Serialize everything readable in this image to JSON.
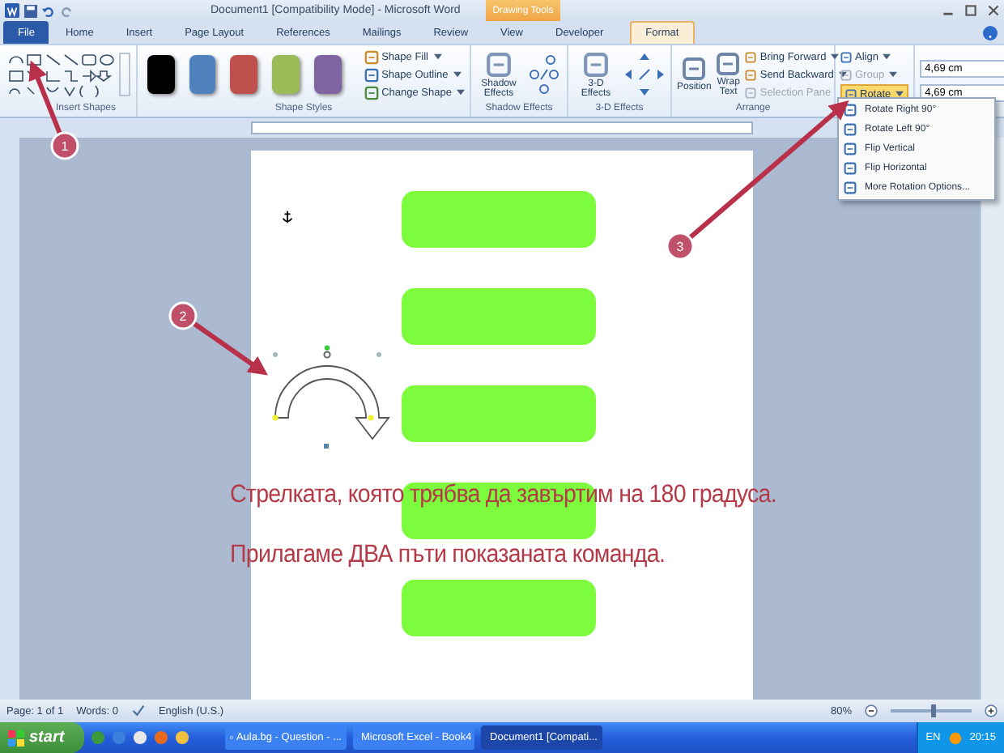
{
  "title_bar": {
    "title": "Document1 [Compatibility Mode] - Microsoft Word",
    "contextual": "Drawing Tools"
  },
  "tabs": [
    {
      "label": "File",
      "kind": "file",
      "selected": false
    },
    {
      "label": "Home",
      "kind": "tab",
      "selected": false
    },
    {
      "label": "Insert",
      "kind": "tab",
      "selected": false
    },
    {
      "label": "Page Layout",
      "kind": "tab",
      "selected": false
    },
    {
      "label": "References",
      "kind": "tab",
      "selected": false
    },
    {
      "label": "Mailings",
      "kind": "tab",
      "selected": false
    },
    {
      "label": "Review",
      "kind": "tab",
      "selected": false
    },
    {
      "label": "View",
      "kind": "tab",
      "selected": false
    },
    {
      "label": "Developer",
      "kind": "tab",
      "selected": false
    },
    {
      "label": "Format",
      "kind": "tab",
      "selected": true
    }
  ],
  "ribbon": {
    "insert_shapes": {
      "label": "Insert Shapes"
    },
    "shape_styles": {
      "label": "Shape Styles",
      "swatches": [
        {
          "color": "#000000"
        },
        {
          "color": "#4f81bd"
        },
        {
          "color": "#c0504d"
        },
        {
          "color": "#9bbb59"
        },
        {
          "color": "#8064a2"
        }
      ],
      "commands": [
        "Shape Fill",
        "Shape Outline",
        "Change Shape"
      ]
    },
    "shadow_effects": {
      "label": "Shadow Effects",
      "button": "Shadow Effects"
    },
    "three_d_effects": {
      "label": "3-D Effects",
      "button": "3-D Effects"
    },
    "arrange": {
      "label": "Arrange",
      "large_buttons": [
        "Position",
        "Wrap Text"
      ],
      "commands": [
        {
          "label": "Bring Forward",
          "disabled": false
        },
        {
          "label": "Send Backward",
          "disabled": false
        },
        {
          "label": "Selection Pane",
          "disabled": true
        }
      ],
      "align": [
        {
          "label": "Align",
          "disabled": false
        },
        {
          "label": "Group",
          "disabled": true
        }
      ],
      "rotate": {
        "label": "Rotate",
        "expanded": true
      }
    },
    "size": {
      "fields": [
        "4,69 cm",
        "4,69 cm"
      ]
    }
  },
  "rotate_menu": [
    {
      "label": "Rotate Right 90°"
    },
    {
      "label": "Rotate Left 90°"
    },
    {
      "label": "Flip Vertical"
    },
    {
      "label": "Flip Horizontal"
    },
    {
      "label": "More Rotation Options..."
    }
  ],
  "document": {
    "boxes": [
      {
        "kind": "rounded-rect"
      },
      {
        "kind": "rounded-rect"
      },
      {
        "kind": "rounded-rect"
      },
      {
        "kind": "rounded-rect"
      },
      {
        "kind": "rounded-rect"
      }
    ],
    "lines": [
      "Стрелката, която трябва да завъртим на 180 градуса.",
      "Прилагаме ДВА пъти показаната команда."
    ]
  },
  "callouts": [
    {
      "label": "1"
    },
    {
      "label": "2"
    },
    {
      "label": "3"
    }
  ],
  "status_bar": {
    "page": "Page: 1 of 1",
    "words": "Words: 0",
    "language": "English (U.S.)",
    "zoom": "80%",
    "zoom_level": {
      "level": 0.5
    }
  },
  "taskbar": {
    "start": "start",
    "tasks": [
      {
        "label": "Aula.bg - Question - ...",
        "selected": false
      },
      {
        "label": "Microsoft Excel - Book4",
        "selected": false
      },
      {
        "label": "Document1 [Compati...",
        "selected": true
      }
    ],
    "language": "EN",
    "clock": "20:15"
  }
}
